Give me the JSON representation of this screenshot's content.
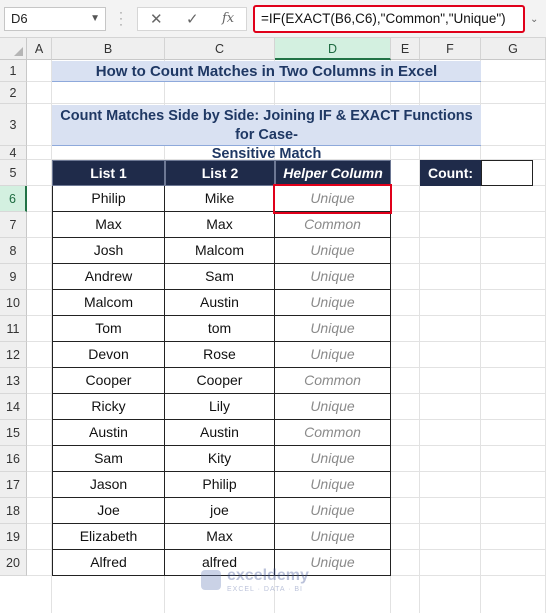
{
  "formula_bar": {
    "name_box": "D6",
    "cancel_icon": "✕",
    "confirm_icon": "✓",
    "fx_label": "fx",
    "formula": "=IF(EXACT(B6,C6),\"Common\",\"Unique\")"
  },
  "columns": [
    "A",
    "B",
    "C",
    "D",
    "E",
    "F",
    "G"
  ],
  "rows": [
    "1",
    "2",
    "3",
    "4",
    "5",
    "6",
    "7",
    "8",
    "9",
    "10",
    "11",
    "12",
    "13",
    "14",
    "15",
    "16",
    "17",
    "18",
    "19",
    "20"
  ],
  "sheet": {
    "title": "How to Count Matches in Two Columns in Excel",
    "subtitle_line1": "Count Matches Side by Side: Joining IF & EXACT Functions for Case-",
    "subtitle_line2": "Sensitive Match",
    "headers": {
      "list1": "List 1",
      "list2": "List 2",
      "helper": "Helper Column"
    },
    "count_label": "Count:",
    "count_value": "",
    "table": [
      [
        "Philip",
        "Mike",
        "Unique"
      ],
      [
        "Max",
        "Max",
        "Common"
      ],
      [
        "Josh",
        "Malcom",
        "Unique"
      ],
      [
        "Andrew",
        "Sam",
        "Unique"
      ],
      [
        "Malcom",
        "Austin",
        "Unique"
      ],
      [
        "Tom",
        "tom",
        "Unique"
      ],
      [
        "Devon",
        "Rose",
        "Unique"
      ],
      [
        "Cooper",
        "Cooper",
        "Common"
      ],
      [
        "Ricky",
        "Lily",
        "Unique"
      ],
      [
        "Austin",
        "Austin",
        "Common"
      ],
      [
        "Sam",
        "Kity",
        "Unique"
      ],
      [
        "Jason",
        "Philip",
        "Unique"
      ],
      [
        "Joe",
        "joe",
        "Unique"
      ],
      [
        "Elizabeth",
        "Max",
        "Unique"
      ],
      [
        "Alfred",
        "alfred",
        "Unique"
      ]
    ]
  },
  "watermark": {
    "name": "exceldemy",
    "tagline": "EXCEL · DATA · BI"
  },
  "colors": {
    "accent_red": "#e0001a",
    "header_navy": "#1f2b4a",
    "title_fill": "#d9e1f2"
  }
}
